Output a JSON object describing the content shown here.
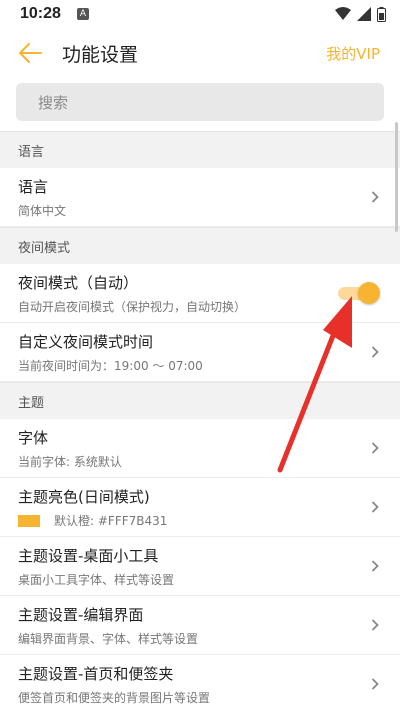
{
  "status_bar": {
    "time": "10:28",
    "badge": "A"
  },
  "app_bar": {
    "title": "功能设置",
    "vip": "我的VIP"
  },
  "search": {
    "placeholder": "搜索"
  },
  "sections": {
    "language": {
      "header": "语言",
      "item": {
        "title": "语言",
        "subtitle": "简体中文"
      }
    },
    "night": {
      "header": "夜间模式",
      "auto": {
        "title": "夜间模式（自动）",
        "subtitle": "自动开启夜间模式（保护视力，自动切换）",
        "enabled": true
      },
      "custom": {
        "title": "自定义夜间模式时间",
        "subtitle": "当前夜间时间为：19:00 ～ 07:00"
      }
    },
    "theme": {
      "header": "主题",
      "font": {
        "title": "字体",
        "subtitle": "当前字体: 系统默认"
      },
      "color": {
        "title": "主题亮色(日间模式)",
        "subtitle": "默认橙: #FFF7B431",
        "swatch_color": "#F7B431"
      },
      "widget": {
        "title": "主题设置-桌面小工具",
        "subtitle": "桌面小工具字体、样式等设置"
      },
      "editor": {
        "title": "主题设置-编辑界面",
        "subtitle": "编辑界面背景、字体、样式等设置"
      },
      "home": {
        "title": "主题设置-首页和便签夹",
        "subtitle": "便签首页和便签夹的背景图片等设置"
      }
    }
  },
  "colors": {
    "accent": "#F7B431",
    "annotation_arrow": "#E8302A"
  }
}
